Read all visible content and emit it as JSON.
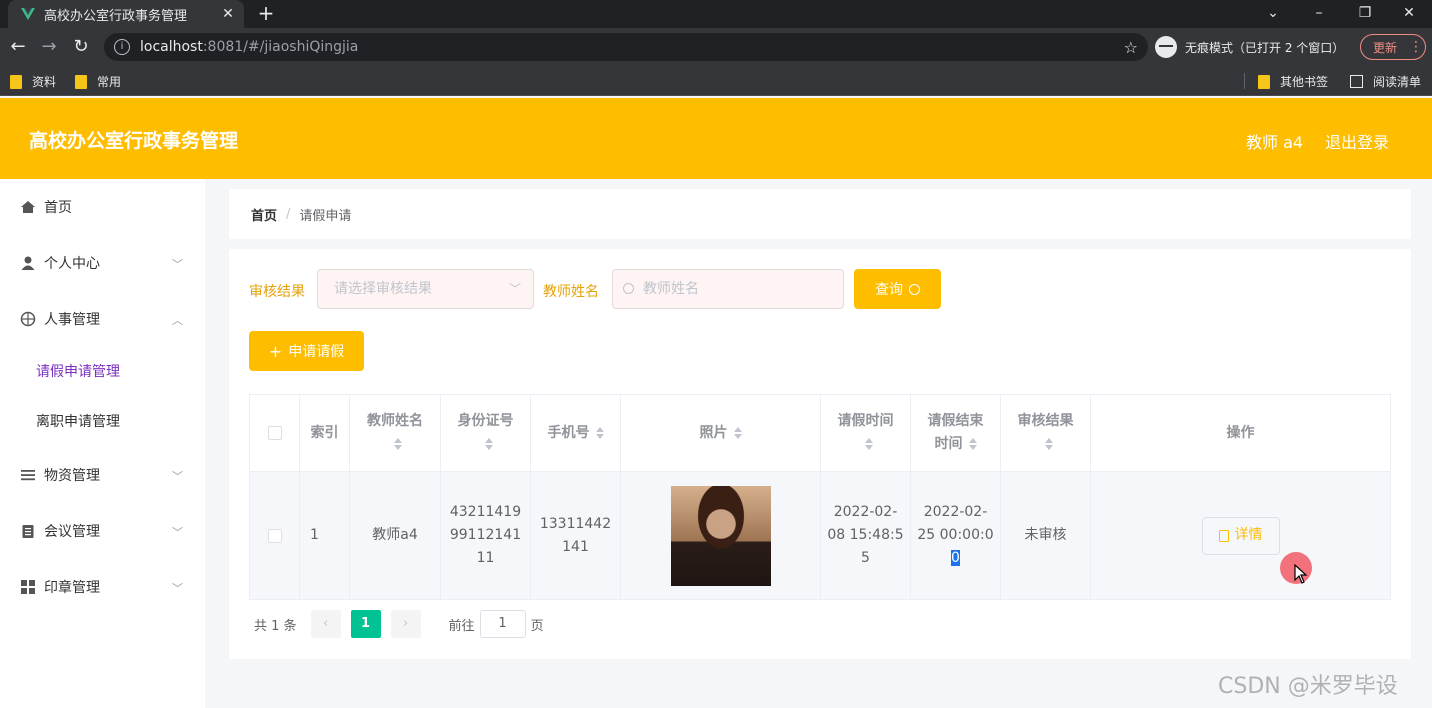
{
  "browser": {
    "tab_title": "高校办公室行政事务管理",
    "tab_close": "✕",
    "new_tab": "+",
    "url_host": "localhost",
    "url_rest": ":8081/#/jiaoshiQingjia",
    "incognito_label": "无痕模式（已打开 2 个窗口）",
    "update_label": "更新",
    "bookmarks": [
      "资料",
      "常用"
    ],
    "bookmarks_right": [
      "其他书签",
      "阅读清单"
    ]
  },
  "header": {
    "title": "高校办公室行政事务管理",
    "user": "教师 a4",
    "logout": "退出登录"
  },
  "sidebar": {
    "items": [
      {
        "label": "首页",
        "icon": "home-icon"
      },
      {
        "label": "个人中心",
        "icon": "user-icon"
      },
      {
        "label": "人事管理",
        "icon": "compass-icon"
      },
      {
        "label": "物资管理",
        "icon": "list-icon"
      },
      {
        "label": "会议管理",
        "icon": "clipboard-icon"
      },
      {
        "label": "印章管理",
        "icon": "grid-icon"
      }
    ],
    "subitems": [
      "请假申请管理",
      "离职申请管理"
    ]
  },
  "breadcrumb": {
    "home": "首页",
    "separator": "/",
    "current": "请假申请"
  },
  "filters": {
    "result_label": "审核结果",
    "result_placeholder": "请选择审核结果",
    "name_label": "教师姓名",
    "name_placeholder": "教师姓名",
    "search_button": "查询",
    "add_button": "申请请假"
  },
  "table": {
    "headers": {
      "index": "索引",
      "name": "教师姓名",
      "id_number": "身份证号",
      "phone": "手机号",
      "photo": "照片",
      "leave_time_1": "请假时间",
      "leave_end_1": "请假结束",
      "leave_end_2": "时间",
      "result": "审核结果",
      "actions": "操作"
    },
    "rows": [
      {
        "index": "1",
        "name": "教师a4",
        "id_1": "43211419",
        "id_2": "99112141",
        "id_3": "11",
        "phone_1": "13311442",
        "phone_2": "141",
        "start_1": "2022-02-",
        "start_2": "08 15:48:5",
        "start_3": "5",
        "end_1": "2022-02-",
        "end_2": "25 00:00:0",
        "end_3": "0",
        "result": "未审核",
        "detail": "详情"
      }
    ]
  },
  "pagination": {
    "total": "共 1 条",
    "prev": "‹",
    "current": "1",
    "next": "›",
    "goto": "前往",
    "goto_value": "1",
    "page_unit": "页"
  },
  "watermark": "CSDN @米罗毕设",
  "colors": {
    "accent": "#ffbd00",
    "active_menu": "#7b2fbe",
    "page_active": "#00c292"
  }
}
